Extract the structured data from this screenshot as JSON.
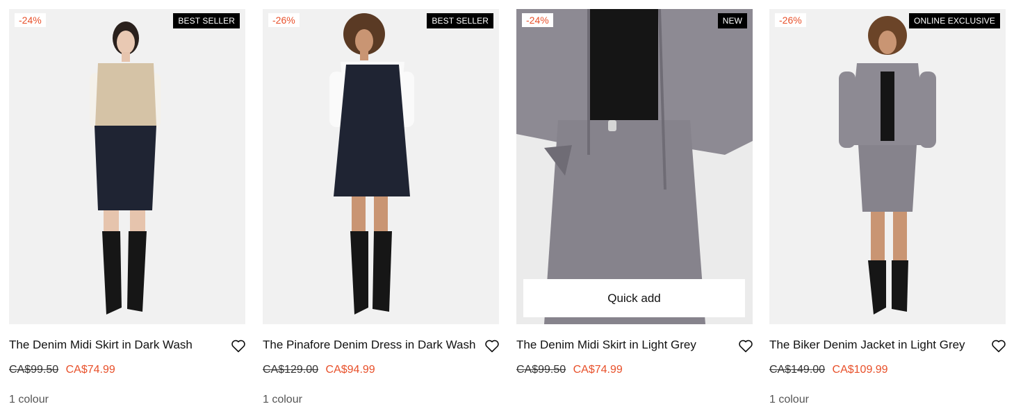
{
  "colors": {
    "sale_red": "#e8502a",
    "badge_bg": "#000000",
    "image_bg": "#f2f2f2",
    "dark_denim": "#1f2433",
    "light_grey_denim": "#8d8a93"
  },
  "products": [
    {
      "discount": "-24%",
      "badge": "BEST SELLER",
      "title": "The Denim Midi Skirt in Dark Wash",
      "was_price": "CA$99.50",
      "sale_price": "CA$74.99",
      "colours": "1 colour",
      "wishlist_icon": "heart-outline-icon"
    },
    {
      "discount": "-26%",
      "badge": "BEST SELLER",
      "title": "The Pinafore Denim Dress in Dark Wash",
      "was_price": "CA$129.00",
      "sale_price": "CA$94.99",
      "colours": "1 colour",
      "wishlist_icon": "heart-outline-icon"
    },
    {
      "discount": "-24%",
      "badge": "NEW",
      "title": "The Denim Midi Skirt in Light Grey",
      "was_price": "CA$99.50",
      "sale_price": "CA$74.99",
      "quick_add_label": "Quick add",
      "wishlist_icon": "heart-outline-icon"
    },
    {
      "discount": "-26%",
      "badge": "ONLINE EXCLUSIVE",
      "title": "The Biker Denim Jacket in Light Grey",
      "was_price": "CA$149.00",
      "sale_price": "CA$109.99",
      "colours": "1 colour",
      "wishlist_icon": "heart-outline-icon"
    }
  ]
}
